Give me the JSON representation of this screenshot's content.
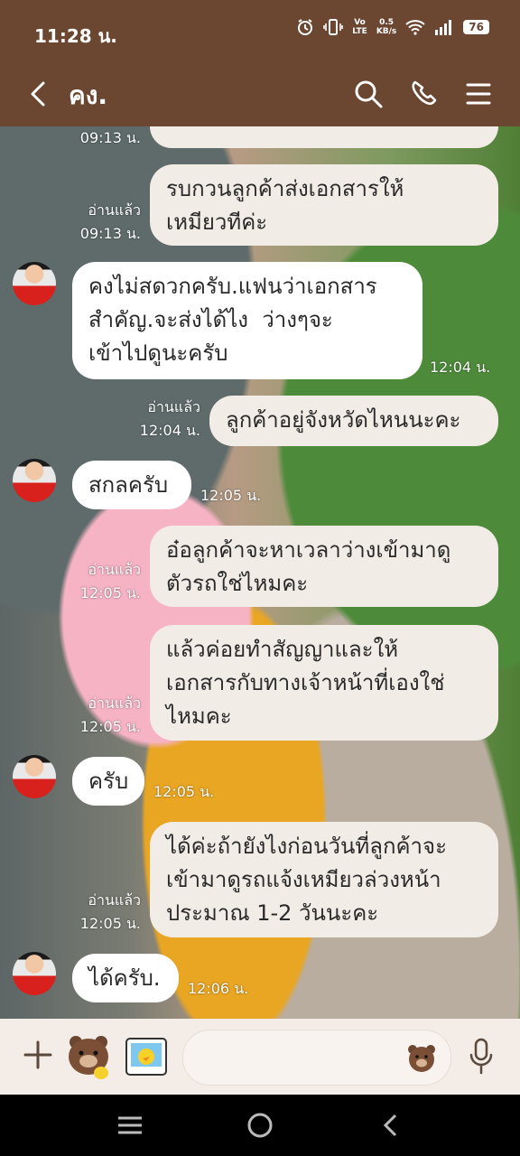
{
  "status_bar": {
    "time": "11:28 น.",
    "network_rate": "0.5\nKB/s",
    "volte": "Vo\nLTE",
    "battery": "76"
  },
  "header": {
    "title": "คง."
  },
  "messages": [
    {
      "id": "m0",
      "side": "me",
      "text": "...",
      "time": "09:13 น.",
      "read": ""
    },
    {
      "id": "m1",
      "side": "me",
      "text": "รบกวนลูกค้าส่งเอกสารให้\nเหมียวทีค่ะ",
      "time": "09:13 น.",
      "read": "อ่านแล้ว"
    },
    {
      "id": "m2",
      "side": "them",
      "text": "คงไม่สดวกครับ.แฟนว่าเอกสาร\nสำคัญ.จะส่งได้ไง  ว่างๆจะ\nเข้าไปดูนะครับ",
      "time": "12:04 น."
    },
    {
      "id": "m3",
      "side": "me",
      "text": "ลูกค้าอยู่จังหวัดไหนนะคะ",
      "time": "12:04 น.",
      "read": "อ่านแล้ว"
    },
    {
      "id": "m4",
      "side": "them",
      "text": "สกลครับ",
      "time": "12:05 น."
    },
    {
      "id": "m5",
      "side": "me",
      "text": "อ๋อลูกค้าจะหาเวลาว่างเข้ามาดู\nตัวรถใช่ไหมคะ",
      "time": "12:05 น.",
      "read": "อ่านแล้ว"
    },
    {
      "id": "m6",
      "side": "me",
      "text": "แล้วค่อยทำสัญญาและให้\nเอกสารกับทางเจ้าหน้าที่เองใช่\nไหมคะ",
      "time": "12:05 น.",
      "read": "อ่านแล้ว"
    },
    {
      "id": "m7",
      "side": "them",
      "text": "ครับ",
      "time": "12:05 น."
    },
    {
      "id": "m8",
      "side": "me",
      "text": "ได้ค่ะถ้ายังไงก่อนวันที่ลูกค้าจะ\nเข้ามาดูรถแจ้งเหมียวล่วงหน้า\nประมาณ 1-2 วันนะคะ",
      "time": "12:05 น.",
      "read": "อ่านแล้ว"
    },
    {
      "id": "m9",
      "side": "them",
      "text": "ได้ครับ.",
      "time": "12:06 น."
    }
  ],
  "colors": {
    "header_bg": "#6b4631",
    "bubble_me": "#f2ece6",
    "bubble_them": "#ffffff",
    "input_bar": "#f3ece7"
  },
  "icons": [
    "back-icon",
    "search-icon",
    "phone-icon",
    "menu-icon",
    "plus-icon",
    "bear-sticker-icon",
    "photo-sticker-icon",
    "bear-emoji-icon",
    "mic-icon",
    "recents-icon",
    "home-icon",
    "nav-back-icon"
  ]
}
